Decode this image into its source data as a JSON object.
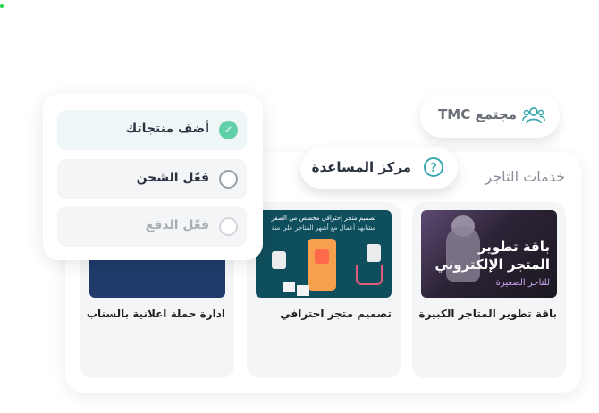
{
  "services_panel": {
    "title": "خدمات التاجر",
    "cards": [
      {
        "label": "باقة تطوير المتاجر الكبيرة",
        "thumb": {
          "line1": "باقة تطوير",
          "line2": "المتجر الإلكتروني",
          "line3": "للتاجر الصغيرة"
        }
      },
      {
        "label": "تصميم متجر احترافي",
        "thumb": {
          "line1": "تصميم متجر إحترافي مخصص من الصفر",
          "line2": "مشابهة أعمال مع أشهر المتاجر على منة"
        }
      },
      {
        "label": "ادارة حملة اعلانية بالسناب"
      }
    ]
  },
  "help_center": {
    "label": "مركز المساعدة",
    "icon": "question-circle-icon",
    "icon_glyph": "?"
  },
  "community": {
    "label": "مجتمع TMC",
    "icon": "users-icon"
  },
  "checklist": {
    "tasks": [
      {
        "label": "أضف منتجاتك",
        "state": "done",
        "check_glyph": "✓"
      },
      {
        "label": "فعّل الشحن",
        "state": "pending"
      },
      {
        "label": "فعّل الدفع",
        "state": "disabled"
      }
    ]
  },
  "colors": {
    "accent": "#3aa9b0",
    "check": "#5fd0a8",
    "text": "#2c3340"
  }
}
